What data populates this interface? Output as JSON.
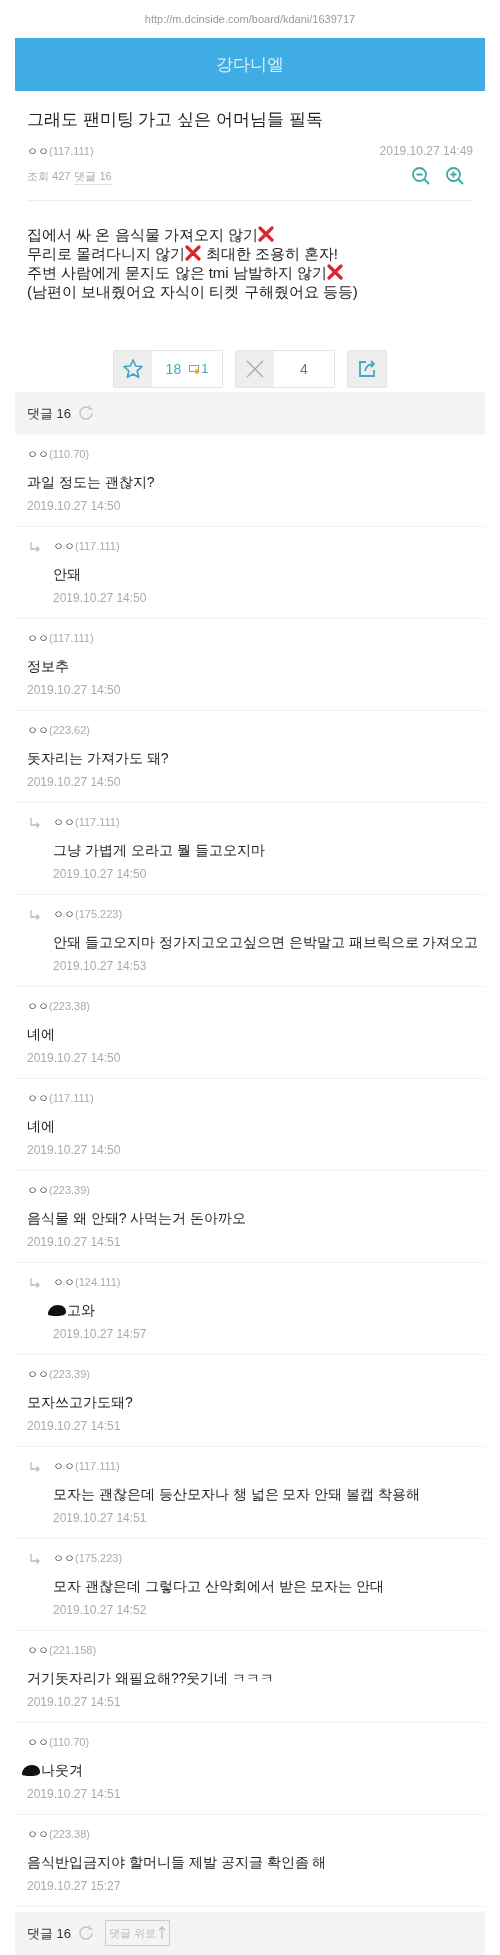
{
  "url": "http://m.dcinside.com/board/kdani/1639717",
  "header": {
    "title": "강다니엘"
  },
  "post": {
    "title": "그래도 팬미팅 가고 싶은 어머님들 필독",
    "author": "ㅇㅇ",
    "ip": "(117.111)",
    "date": "2019.10.27 14:49",
    "views": "조회 427",
    "comments_link": "댓글 16",
    "body": [
      [
        {
          "kind": "text",
          "text": "집에서 싸 온 음식물 가져오지 않기"
        },
        {
          "kind": "x-mark"
        }
      ],
      [
        {
          "kind": "text",
          "text": "무리로 몰려다니지 않기"
        },
        {
          "kind": "x-mark"
        },
        {
          "kind": "text",
          "text": " 최대한 조용히 혼자!"
        }
      ],
      [
        {
          "kind": "text",
          "text": "주변 사람에게 묻지도 않은 tmi 남발하지 않기"
        },
        {
          "kind": "x-mark"
        }
      ],
      [
        {
          "kind": "text",
          "text": "(남편이 보내줬어요 자식이 티켓 구해줬어요 등등)"
        }
      ]
    ]
  },
  "actions": {
    "recommend": "18",
    "gold_recommend": "1",
    "dislike": "4"
  },
  "comments_header": {
    "label": "댓글 16"
  },
  "comments": [
    {
      "reply": false,
      "author": "ㅇㅇ",
      "ip": "(110.70)",
      "text": "과일 정도는 괜찮지?",
      "date": "2019.10.27 14:50",
      "redacted": false
    },
    {
      "reply": true,
      "author": "ㅇㅇ",
      "ip": "(117.111)",
      "text": "안돼",
      "date": "2019.10.27 14:50",
      "redacted": false
    },
    {
      "reply": false,
      "author": "ㅇㅇ",
      "ip": "(117.111)",
      "text": "정보추",
      "date": "2019.10.27 14:50",
      "redacted": false
    },
    {
      "reply": false,
      "author": "ㅇㅇ",
      "ip": "(223.62)",
      "text": "돗자리는 가져가도 돼?",
      "date": "2019.10.27 14:50",
      "redacted": false
    },
    {
      "reply": true,
      "author": "ㅇㅇ",
      "ip": "(117.111)",
      "text": "그냥 가볍게 오라고 뭘 들고오지마",
      "date": "2019.10.27 14:50",
      "redacted": false
    },
    {
      "reply": true,
      "author": "ㅇㅇ",
      "ip": "(175.223)",
      "text": "안돼 들고오지마 정가지고오고싶으면 은박말고 패브릭으로 가져오고",
      "date": "2019.10.27 14:53",
      "redacted": false
    },
    {
      "reply": false,
      "author": "ㅇㅇ",
      "ip": "(223.38)",
      "text": "녜에",
      "date": "2019.10.27 14:50",
      "redacted": false
    },
    {
      "reply": false,
      "author": "ㅇㅇ",
      "ip": "(117.111)",
      "text": "녜에",
      "date": "2019.10.27 14:50",
      "redacted": false
    },
    {
      "reply": false,
      "author": "ㅇㅇ",
      "ip": "(223.39)",
      "text": "음식물 왜 안돼? 사먹는거 돈아까오",
      "date": "2019.10.27 14:51",
      "redacted": false
    },
    {
      "reply": true,
      "author": "ㅇㅇ",
      "ip": "(124.111)",
      "text": "고와",
      "date": "2019.10.27 14:57",
      "redacted": true
    },
    {
      "reply": false,
      "author": "ㅇㅇ",
      "ip": "(223.39)",
      "text": "모자쓰고가도돼?",
      "date": "2019.10.27 14:51",
      "redacted": false
    },
    {
      "reply": true,
      "author": "ㅇㅇ",
      "ip": "(117.111)",
      "text": "모자는 괜찮은데 등산모자나 챙 넓은 모자 안돼 볼캡 착용해",
      "date": "2019.10.27 14:51",
      "redacted": false
    },
    {
      "reply": true,
      "author": "ㅇㅇ",
      "ip": "(175.223)",
      "text": "모자 괜찮은데 그렇다고 산악회에서 받은 모자는 안대",
      "date": "2019.10.27 14:52",
      "redacted": false
    },
    {
      "reply": false,
      "author": "ㅇㅇ",
      "ip": "(221.158)",
      "text": "거기돗자리가 왜필요해??웃기네 ㅋㅋㅋ",
      "date": "2019.10.27 14:51",
      "redacted": false
    },
    {
      "reply": false,
      "author": "ㅇㅇ",
      "ip": "(110.70)",
      "text": "나웃겨",
      "date": "2019.10.27 14:51",
      "redacted": true
    },
    {
      "reply": false,
      "author": "ㅇㅇ",
      "ip": "(223.38)",
      "text": "음식반입금지야 할머니들 제발 공지글 확인좀 해",
      "date": "2019.10.27 15:27",
      "redacted": false
    }
  ],
  "footer": {
    "label": "댓글 16",
    "to_top": "댓글 위로"
  }
}
